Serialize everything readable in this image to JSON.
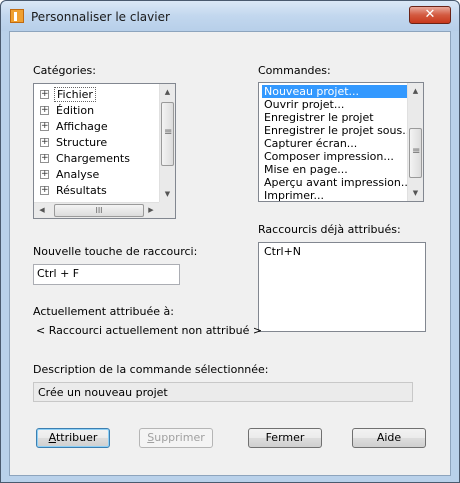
{
  "window": {
    "title": "Personnaliser le clavier",
    "close_glyph": "✕"
  },
  "categories": {
    "label": "Catégories:",
    "items": [
      {
        "label": "Fichier"
      },
      {
        "label": "Édition"
      },
      {
        "label": "Affichage"
      },
      {
        "label": "Structure"
      },
      {
        "label": "Chargements"
      },
      {
        "label": "Analyse"
      },
      {
        "label": "Résultats"
      }
    ],
    "selected_index": 0,
    "expand_glyph": "+"
  },
  "commands": {
    "label": "Commandes:",
    "items": [
      "Nouveau projet...",
      "Ouvrir projet...",
      "Enregistrer le projet",
      "Enregistrer le projet sous...",
      "Capturer écran...",
      "Composer impression...",
      "Mise en page...",
      "Aperçu avant impression...",
      "Imprimer..."
    ],
    "selected_index": 0
  },
  "new_shortcut": {
    "label": "Nouvelle touche de raccourci:",
    "value": "Ctrl + F"
  },
  "assigned": {
    "label": "Raccourcis déjà attribués:",
    "items": [
      "Ctrl+N"
    ]
  },
  "current": {
    "label": "Actuellement attribuée à:",
    "value": "< Raccourci actuellement non attribué >"
  },
  "description": {
    "label": "Description de la commande sélectionnée:",
    "value": "Crée un nouveau projet"
  },
  "buttons": {
    "assign": {
      "label": "Attribuer",
      "mnemonic": "A",
      "rest": "ttribuer"
    },
    "remove": {
      "label": "Supprimer",
      "mnemonic": "S",
      "rest": "upprimer"
    },
    "close": {
      "label": "Fermer"
    },
    "help": {
      "label": "Aide"
    }
  },
  "scroll_glyphs": {
    "up": "▲",
    "down": "▼",
    "left": "◀",
    "right": "▶",
    "grip": "III"
  }
}
